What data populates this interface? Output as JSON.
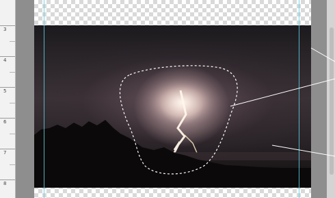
{
  "ruler": {
    "labels": [
      "3",
      "4",
      "5",
      "6",
      "7",
      "8"
    ]
  },
  "colors": {
    "guide": "#5fd0e6",
    "pasteboard": "#8e8e8e",
    "selection": "#ffffff"
  },
  "icons": {
    "selection": "marching-ants-selection"
  }
}
